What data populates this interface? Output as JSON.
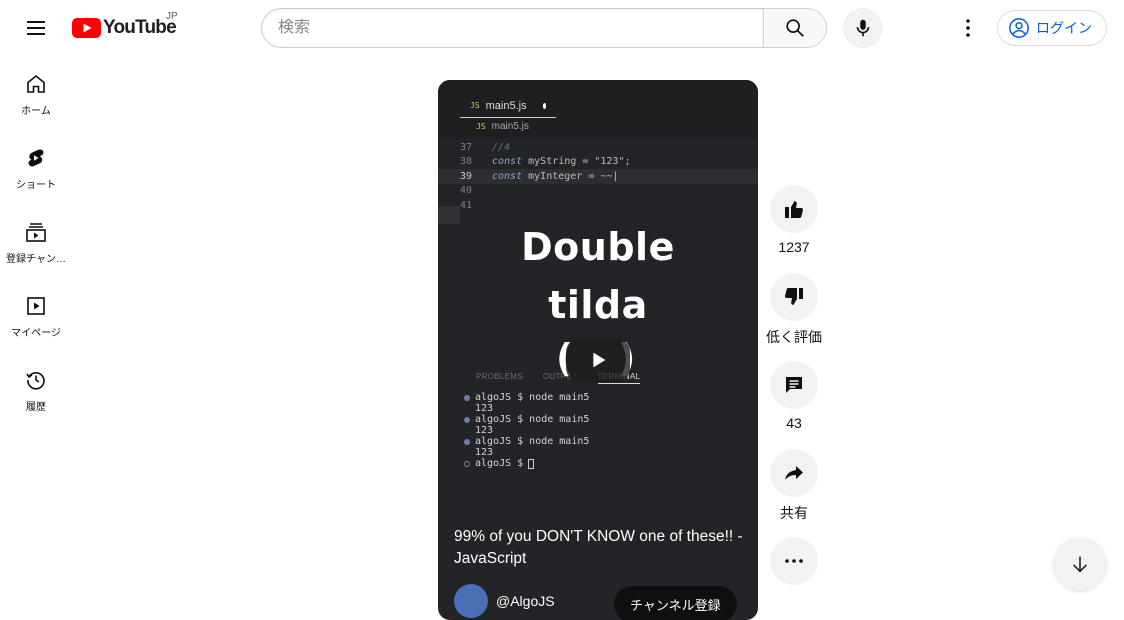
{
  "masthead": {
    "logo_text": "YouTube",
    "country_code": "JP",
    "search_placeholder": "検索",
    "login_label": "ログイン"
  },
  "guide": {
    "items": [
      {
        "label": "ホーム",
        "icon": "home-icon"
      },
      {
        "label": "ショート",
        "icon": "shorts-icon"
      },
      {
        "label": "登録チャン…",
        "icon": "subscriptions-icon"
      },
      {
        "label": "マイページ",
        "icon": "library-icon"
      },
      {
        "label": "履歴",
        "icon": "history-icon"
      }
    ]
  },
  "short": {
    "editor": {
      "tab_lang": "JS",
      "tab_file": "main5.js",
      "breadcrumb_file": "main5.js",
      "lines": [
        {
          "num": "37",
          "comment": "//4"
        },
        {
          "num": "38",
          "keyword": "const",
          "rest": " myString = \"123\";"
        },
        {
          "num": "39",
          "keyword": "const",
          "rest": " myInteger = ~~|"
        },
        {
          "num": "40"
        },
        {
          "num": "41"
        }
      ],
      "panel_tabs": [
        "PROBLEMS",
        "OUTPUT",
        "TERMINAL"
      ],
      "terminal": {
        "prompt": "algoJS $ node main5",
        "output": "123",
        "last_prompt": "algoJS $"
      }
    },
    "overlay_line1": "Double",
    "overlay_line2": "tilda",
    "overlay_paren_left": "(",
    "overlay_paren_right": ")",
    "title": "99% of you DON'T KNOW one of these!! - JavaScript",
    "channel_name": "@AlgoJS",
    "subscribe_label": "チャンネル登録"
  },
  "actions": {
    "like_count": "1237",
    "dislike_label": "低く評価",
    "comment_count": "43",
    "share_label": "共有"
  },
  "colors": {
    "youtube_red": "#ff0000",
    "link_blue": "#065fd4",
    "player_bg": "#222427"
  }
}
